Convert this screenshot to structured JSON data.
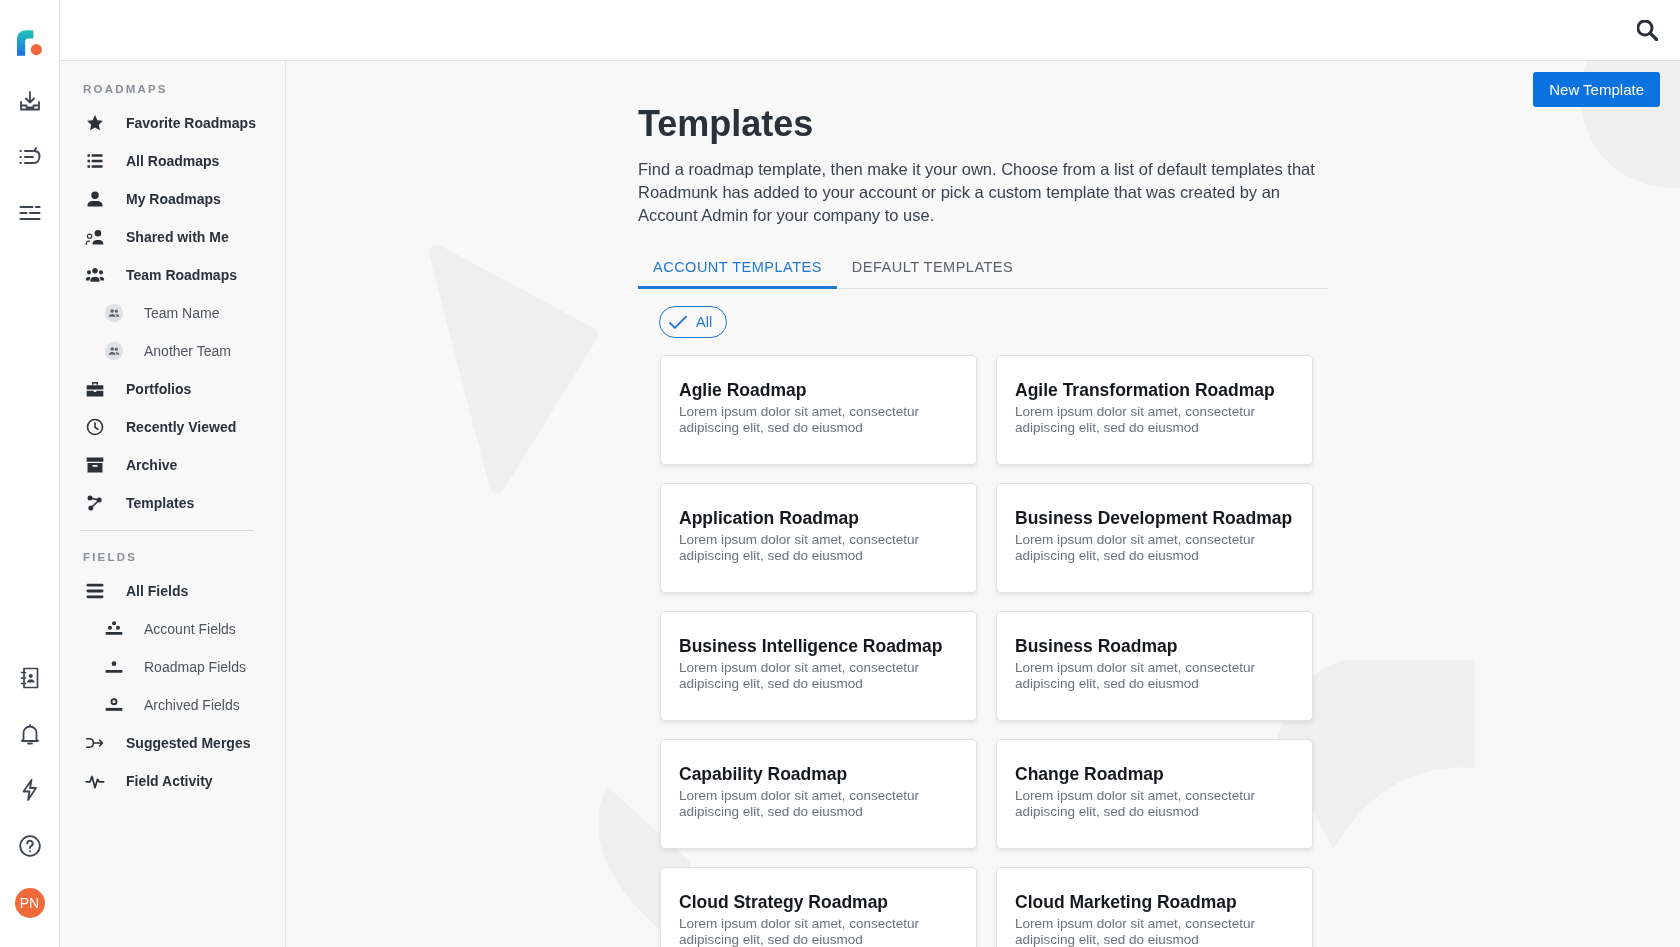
{
  "rail": {
    "avatar_initials": "PN"
  },
  "sidebar": {
    "sections": [
      {
        "heading": "ROADMAPS",
        "items": [
          {
            "label": "Favorite Roadmaps"
          },
          {
            "label": "All Roadmaps"
          },
          {
            "label": "My Roadmaps"
          },
          {
            "label": "Shared with Me"
          },
          {
            "label": "Team Roadmaps",
            "children": [
              {
                "label": "Team Name"
              },
              {
                "label": "Another Team"
              }
            ]
          },
          {
            "label": "Portfolios"
          },
          {
            "label": "Recently Viewed"
          },
          {
            "label": "Archive"
          },
          {
            "label": "Templates"
          }
        ]
      },
      {
        "heading": "FIELDS",
        "items": [
          {
            "label": "All Fields",
            "children": [
              {
                "label": "Account Fields"
              },
              {
                "label": "Roadmap Fields"
              },
              {
                "label": "Archived Fields"
              }
            ]
          },
          {
            "label": "Suggested Merges"
          },
          {
            "label": "Field Activity"
          }
        ]
      }
    ]
  },
  "toolbar": {
    "new_template_button": "New Template"
  },
  "page": {
    "title": "Templates",
    "description": "Find a roadmap template, then make it your own. Choose from a list of default templates that Roadmunk has added to your account or pick a custom template that was created by an Account Admin for your company to use."
  },
  "tabs": [
    {
      "label": "ACCOUNT TEMPLATES",
      "selected": true
    },
    {
      "label": "DEFAULT TEMPLATES",
      "selected": false
    }
  ],
  "filters": [
    {
      "label": "All",
      "selected": true
    }
  ],
  "templates": [
    {
      "title": "Aglie Roadmap",
      "description": "Lorem ipsum dolor sit amet, consectetur adipiscing elit, sed do eiusmod"
    },
    {
      "title": "Agile Transformation Roadmap",
      "description": "Lorem ipsum dolor sit amet, consectetur adipiscing elit, sed do eiusmod"
    },
    {
      "title": "Application Roadmap",
      "description": "Lorem ipsum dolor sit amet, consectetur adipiscing elit, sed do eiusmod"
    },
    {
      "title": "Business Development Roadmap",
      "description": "Lorem ipsum dolor sit amet, consectetur adipiscing elit, sed do eiusmod"
    },
    {
      "title": "Business Intelligence Roadmap",
      "description": "Lorem ipsum dolor sit amet, consectetur adipiscing elit, sed do eiusmod"
    },
    {
      "title": "Business Roadmap",
      "description": "Lorem ipsum dolor sit amet, consectetur adipiscing elit, sed do eiusmod"
    },
    {
      "title": "Capability Roadmap",
      "description": "Lorem ipsum dolor sit amet, consectetur adipiscing elit, sed do eiusmod"
    },
    {
      "title": "Change Roadmap",
      "description": "Lorem ipsum dolor sit amet, consectetur adipiscing elit, sed do eiusmod"
    },
    {
      "title": "Cloud Strategy Roadmap",
      "description": "Lorem ipsum dolor sit amet, consectetur adipiscing elit, sed do eiusmod"
    },
    {
      "title": "Cloud Marketing Roadmap",
      "description": "Lorem ipsum dolor sit amet, consectetur adipiscing elit, sed do eiusmod"
    }
  ]
}
